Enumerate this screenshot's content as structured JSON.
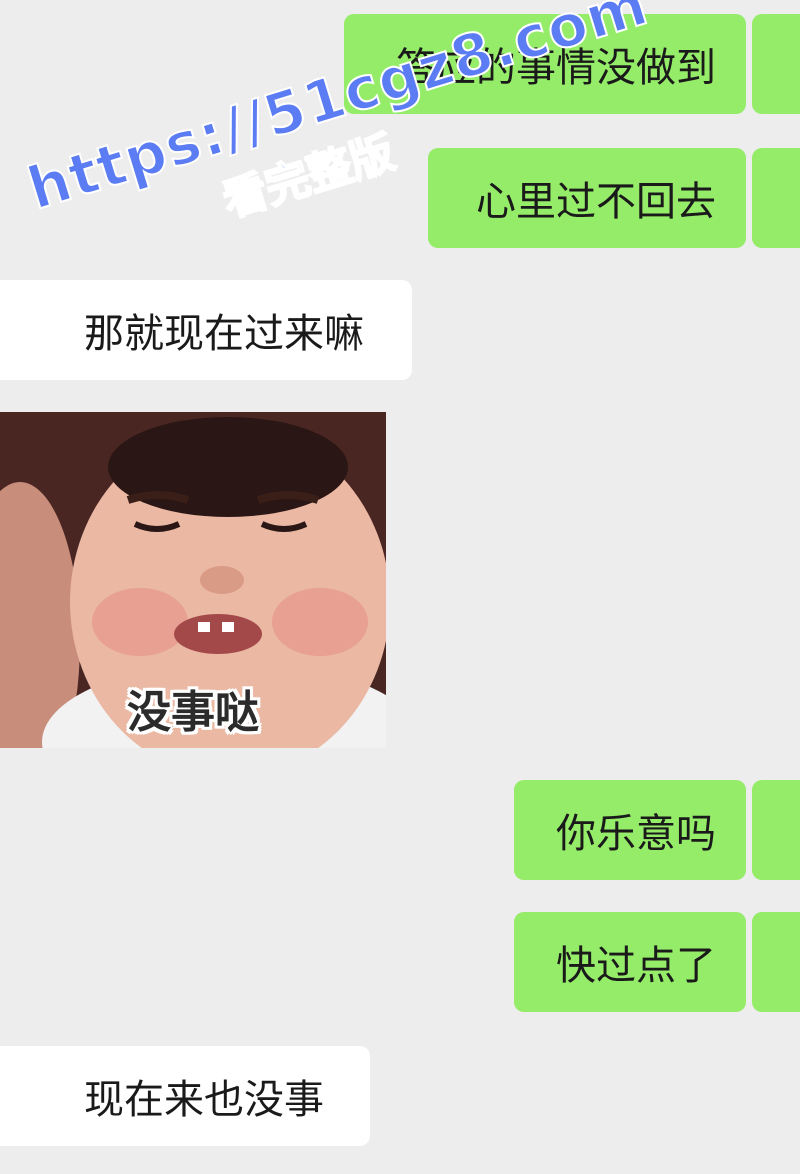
{
  "messages": [
    {
      "side": "out",
      "text": "答应的事情没做到"
    },
    {
      "side": "out",
      "text": "心里过不回去"
    },
    {
      "side": "in",
      "text": "那就现在过来嘛"
    },
    {
      "side": "in",
      "type": "sticker",
      "caption": "没事哒"
    },
    {
      "side": "out",
      "text": "你乐意吗"
    },
    {
      "side": "out",
      "text": "快过点了"
    },
    {
      "side": "in",
      "text": "现在来也没事"
    }
  ],
  "watermark": {
    "line1": "https://51cgz8.com",
    "line2": "看完整版"
  },
  "colors": {
    "background": "#ededed",
    "outgoing_bubble": "#95ec69",
    "incoming_bubble": "#ffffff",
    "watermark": "#5b7cf2"
  }
}
